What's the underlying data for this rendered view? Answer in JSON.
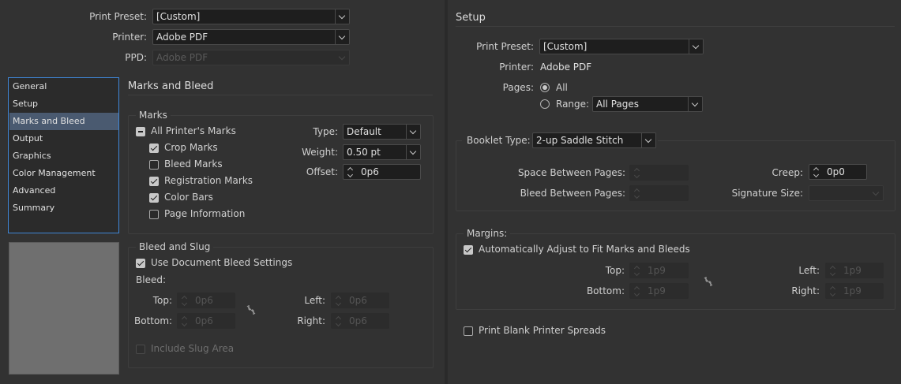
{
  "left_top": {
    "print_preset_label": "Print Preset:",
    "print_preset_value": "[Custom]",
    "printer_label": "Printer:",
    "printer_value": "Adobe PDF",
    "ppd_label": "PPD:",
    "ppd_value": "Adobe PDF"
  },
  "sidebar": {
    "items": [
      {
        "label": "General"
      },
      {
        "label": "Setup"
      },
      {
        "label": "Marks and Bleed",
        "active": true
      },
      {
        "label": "Output"
      },
      {
        "label": "Graphics"
      },
      {
        "label": "Color Management"
      },
      {
        "label": "Advanced"
      },
      {
        "label": "Summary"
      }
    ]
  },
  "marks_bleed": {
    "section_title": "Marks and Bleed",
    "marks": {
      "group_title": "Marks",
      "all_printers_marks": "All Printer's Marks",
      "crop_marks": "Crop Marks",
      "bleed_marks": "Bleed Marks",
      "registration_marks": "Registration Marks",
      "color_bars": "Color Bars",
      "page_information": "Page Information",
      "type_label": "Type:",
      "type_value": "Default",
      "weight_label": "Weight:",
      "weight_value": "0.50 pt",
      "offset_label": "Offset:",
      "offset_value": "0p6"
    },
    "bleed_slug": {
      "group_title": "Bleed and Slug",
      "use_document_bleed": "Use Document Bleed Settings",
      "bleed_label": "Bleed:",
      "top_label": "Top:",
      "top_value": "0p6",
      "bottom_label": "Bottom:",
      "bottom_value": "0p6",
      "left_label": "Left:",
      "left_value": "0p6",
      "right_label": "Right:",
      "right_value": "0p6",
      "include_slug": "Include Slug Area"
    }
  },
  "setup": {
    "title": "Setup",
    "print_preset_label": "Print Preset:",
    "print_preset_value": "[Custom]",
    "printer_label": "Printer:",
    "printer_value": "Adobe PDF",
    "pages_label": "Pages:",
    "all_label": "All",
    "range_label": "Range:",
    "range_value": "All Pages",
    "booklet_type_label": "Booklet Type:",
    "booklet_type_value": "2-up Saddle Stitch",
    "space_between_label": "Space Between Pages:",
    "bleed_between_label": "Bleed Between Pages:",
    "creep_label": "Creep:",
    "creep_value": "0p0",
    "signature_size_label": "Signature Size:",
    "margins_title": "Margins:",
    "auto_adjust": "Automatically Adjust to Fit Marks and Bleeds",
    "top_label": "Top:",
    "top_value": "1p9",
    "bottom_label": "Bottom:",
    "bottom_value": "1p9",
    "left_label": "Left:",
    "left_value": "1p9",
    "right_label": "Right:",
    "right_value": "1p9",
    "print_blank_spreads": "Print Blank Printer Spreads"
  },
  "colors": {
    "background": "#323232",
    "field": "#1e1e1e",
    "active_nav": "#4a5a70",
    "focus_border": "#3f86d6"
  }
}
